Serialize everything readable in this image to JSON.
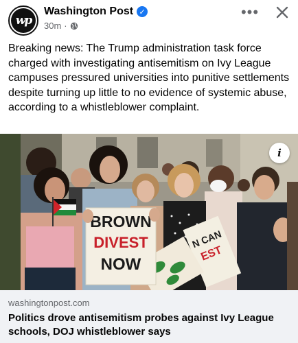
{
  "post": {
    "page_name": "Washington Post",
    "avatar_initials": "wp",
    "time": "30m",
    "separator": "·",
    "text": "Breaking news: The Trump administration task force charged with investigating antisemitism on Ivy League campuses pressured universities into punitive settlements despite turning up little to no evidence of systemic abuse, according to a whistleblower complaint.",
    "more_label": "•••",
    "info_label": "i"
  },
  "photo": {
    "sign_main_line1": "BROWN",
    "sign_main_line2": "DIVEST",
    "sign_main_line3": "NOW",
    "sign_side_line1": "N CAN",
    "sign_side_line2": "EST"
  },
  "link": {
    "domain": "washingtonpost.com",
    "title": "Politics drove antisemitism probes against Ivy League schools, DOJ whistleblower says"
  },
  "colors": {
    "verified": "#1877f2",
    "meta_text": "#65676b",
    "card_bg": "#f0f2f5"
  }
}
